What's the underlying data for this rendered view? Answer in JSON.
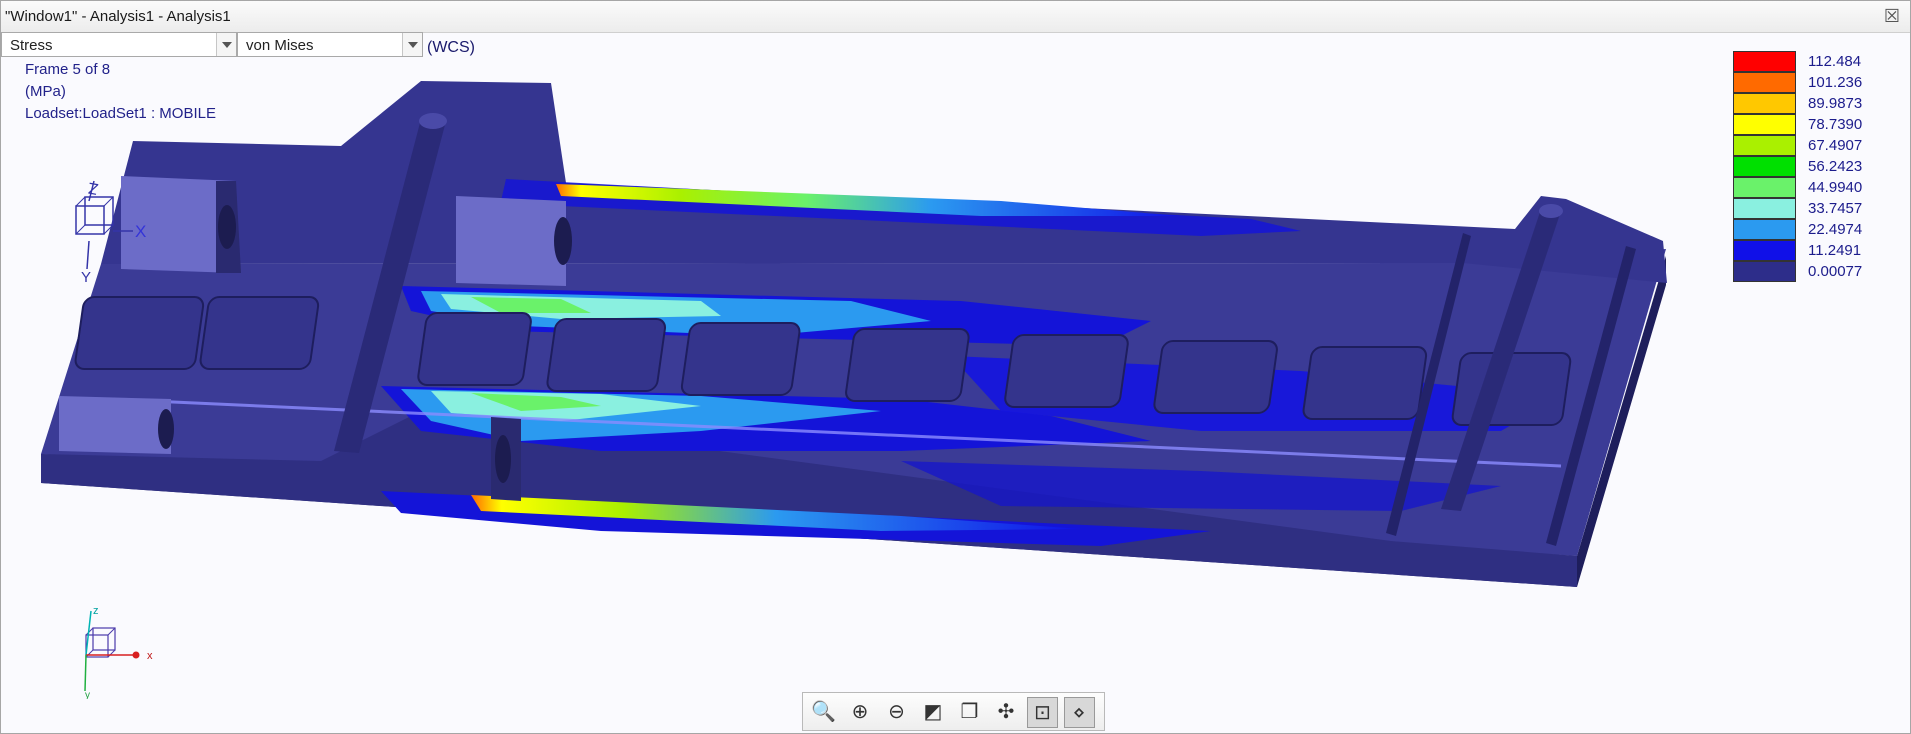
{
  "window": {
    "title": "\"Window1\" - Analysis1 - Analysis1",
    "close_glyph": "☒"
  },
  "quantity_combo": {
    "value": "Stress"
  },
  "component_combo": {
    "value": "von Mises"
  },
  "coord_system": "(WCS)",
  "result_info": {
    "frame": "Frame 5 of 8",
    "units": "(MPa)",
    "loadset": "Loadset:LoadSet1 :  MOBILE"
  },
  "legend": [
    {
      "value": "112.484",
      "color": "#ff0000"
    },
    {
      "value": "101.236",
      "color": "#ff6a00"
    },
    {
      "value": "89.9873",
      "color": "#ffc800"
    },
    {
      "value": "78.7390",
      "color": "#ffff00"
    },
    {
      "value": "67.4907",
      "color": "#aaf000"
    },
    {
      "value": "56.2423",
      "color": "#00e000"
    },
    {
      "value": "44.9940",
      "color": "#6af26a"
    },
    {
      "value": "33.7457",
      "color": "#8af0e0"
    },
    {
      "value": "22.4974",
      "color": "#2b9af0"
    },
    {
      "value": "11.2491",
      "color": "#1010e8"
    },
    {
      "value": "0.00077",
      "color": "#2d2d8a"
    }
  ],
  "model_triad": {
    "x": "X",
    "y": "Y",
    "z": "Z"
  },
  "global_triad": {
    "x": "x",
    "y": "y",
    "z": "z"
  },
  "toolbar": {
    "buttons": [
      {
        "name": "refit-button",
        "icon": "magnifier-icon",
        "glyph": "🔍"
      },
      {
        "name": "zoom-in-button",
        "icon": "zoom-in-icon",
        "glyph": "⊕"
      },
      {
        "name": "zoom-out-button",
        "icon": "zoom-out-icon",
        "glyph": "⊖"
      },
      {
        "name": "repaint-button",
        "icon": "repaint-icon",
        "glyph": "◩"
      },
      {
        "name": "saved-views-button",
        "icon": "saved-views-icon",
        "glyph": "❐"
      },
      {
        "name": "spin-center-button",
        "icon": "spin-center-icon",
        "glyph": "✣"
      },
      {
        "name": "show-model-button",
        "icon": "model-display-icon",
        "glyph": "⊡"
      },
      {
        "name": "probe-button",
        "icon": "probe-icon",
        "glyph": "⋄"
      }
    ]
  }
}
